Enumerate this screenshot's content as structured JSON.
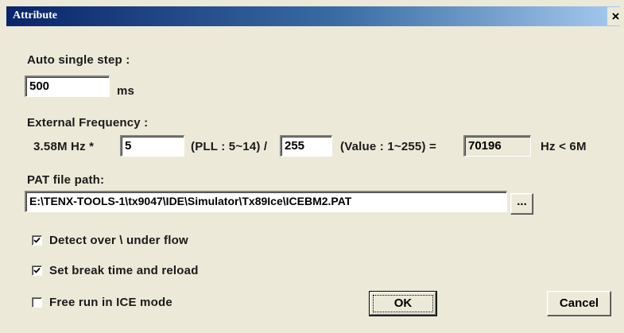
{
  "window": {
    "title": "Attribute",
    "close_label": "×"
  },
  "auto_step": {
    "label": "Auto single step :",
    "value": "500",
    "unit": "ms"
  },
  "external_frequency": {
    "label": "External Frequency :",
    "base_text": "3.58M Hz *",
    "pll_value": "5",
    "pll_hint": "(PLL : 5~14) /",
    "divider_value": "255",
    "divider_hint": "(Value : 1~255) =",
    "result_value": "70196",
    "result_unit": "Hz < 6M"
  },
  "pat_file": {
    "label": "PAT file path:",
    "value": "E:\\TENX-TOOLS-1\\tx9047\\IDE\\Simulator\\Tx89Ice\\ICEBM2.PAT",
    "browse_label": "..."
  },
  "options": [
    {
      "label": "Detect over \\ under flow",
      "checked": true
    },
    {
      "label": "Set break time and reload",
      "checked": true
    },
    {
      "label": "Free run in ICE mode",
      "checked": false
    }
  ],
  "buttons": {
    "ok": "OK",
    "cancel": "Cancel"
  }
}
